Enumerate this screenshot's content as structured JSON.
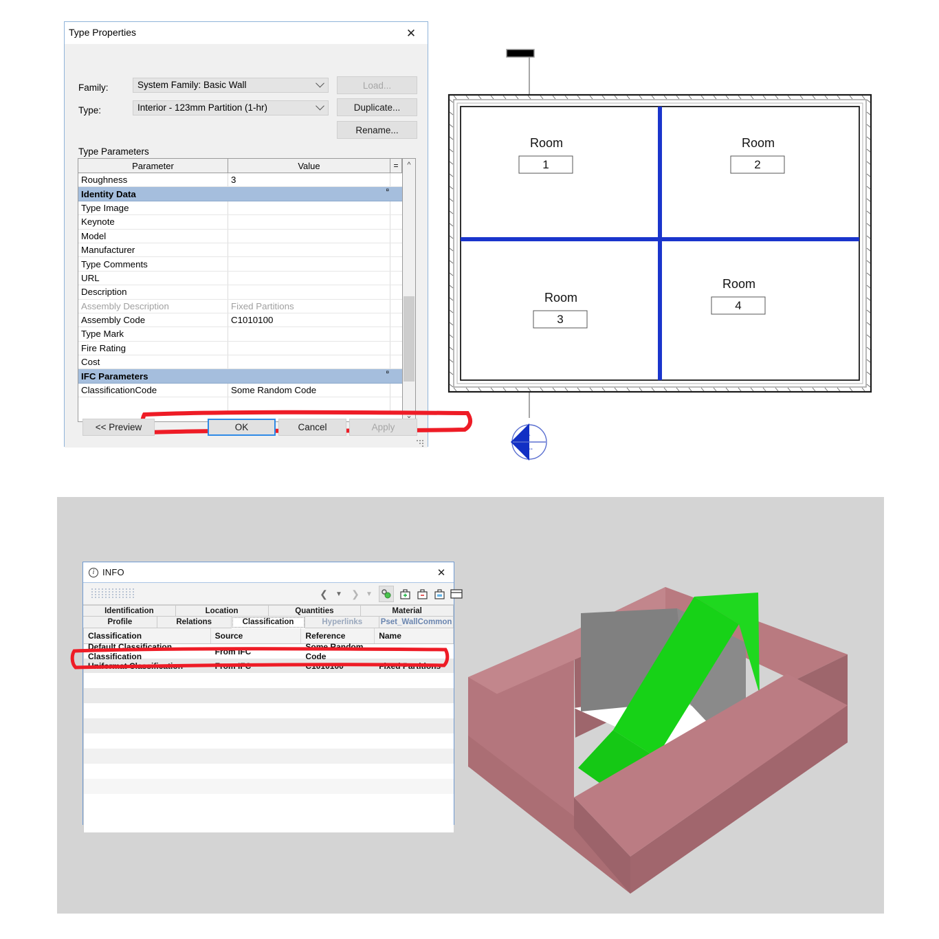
{
  "type_properties": {
    "title": "Type Properties",
    "close_label": "✕",
    "family_label": "Family:",
    "family_value": "System Family: Basic Wall",
    "type_label": "Type:",
    "type_value": "Interior - 123mm Partition (1-hr)",
    "load_button": "Load...",
    "duplicate_button": "Duplicate...",
    "rename_button": "Rename...",
    "type_parameters_label": "Type Parameters",
    "columns": {
      "parameter": "Parameter",
      "value": "Value",
      "equals": "="
    },
    "rows": [
      {
        "kind": "param",
        "parameter": "Roughness",
        "value": "3"
      },
      {
        "kind": "group",
        "parameter": "Identity Data",
        "value": ""
      },
      {
        "kind": "param",
        "parameter": "Type Image",
        "value": ""
      },
      {
        "kind": "param",
        "parameter": "Keynote",
        "value": ""
      },
      {
        "kind": "param",
        "parameter": "Model",
        "value": ""
      },
      {
        "kind": "param",
        "parameter": "Manufacturer",
        "value": ""
      },
      {
        "kind": "param",
        "parameter": "Type Comments",
        "value": ""
      },
      {
        "kind": "param",
        "parameter": "URL",
        "value": ""
      },
      {
        "kind": "param",
        "parameter": "Description",
        "value": ""
      },
      {
        "kind": "dim",
        "parameter": "Assembly Description",
        "value": "Fixed Partitions"
      },
      {
        "kind": "param",
        "parameter": "Assembly Code",
        "value": "C1010100"
      },
      {
        "kind": "param",
        "parameter": "Type Mark",
        "value": ""
      },
      {
        "kind": "param",
        "parameter": "Fire Rating",
        "value": ""
      },
      {
        "kind": "param",
        "parameter": "Cost",
        "value": ""
      },
      {
        "kind": "group",
        "parameter": "IFC Parameters",
        "value": ""
      },
      {
        "kind": "param",
        "parameter": "ClassificationCode",
        "value": "Some Random Code"
      },
      {
        "kind": "blank",
        "parameter": "",
        "value": ""
      }
    ],
    "preview_button": "<< Preview",
    "ok_button": "OK",
    "cancel_button": "Cancel",
    "apply_button": "Apply",
    "highlight_color": "#ee1c26",
    "group_row_color": "#a5bedd"
  },
  "floor_plan": {
    "rooms": [
      {
        "name": "Room",
        "number": "1"
      },
      {
        "name": "Room",
        "number": "2"
      },
      {
        "name": "Room",
        "number": "3"
      },
      {
        "name": "Room",
        "number": "4"
      }
    ],
    "interior_wall_color": "#1a35cc",
    "section_marker": {
      "head_label": "-",
      "tail_label": "---",
      "color": "#1230c4"
    }
  },
  "info_dialog": {
    "title": "INFO",
    "info_icon": "i",
    "close_label": "✕",
    "toolbar_icons": [
      "prev-icon",
      "prev-dropdown-icon",
      "next-icon",
      "next-dropdown-icon",
      "property-link-icon",
      "add-property-icon",
      "remove-property-icon",
      "edit-property-icon",
      "layout-icon"
    ],
    "tabs_row1": [
      {
        "label": "Identification",
        "state": "normal"
      },
      {
        "label": "Location",
        "state": "normal"
      },
      {
        "label": "Quantities",
        "state": "normal"
      },
      {
        "label": "Material",
        "state": "normal"
      }
    ],
    "tabs_row2": [
      {
        "label": "Profile",
        "state": "normal"
      },
      {
        "label": "Relations",
        "state": "normal"
      },
      {
        "label": "Classification",
        "state": "active"
      },
      {
        "label": "Hyperlinks",
        "state": "muted"
      },
      {
        "label": "Pset_WallCommon",
        "state": "linkish"
      }
    ],
    "columns": [
      "Classification",
      "Source",
      "Reference",
      "Name"
    ],
    "rows": [
      {
        "classification": "Default Classification Classification",
        "source": "From IFC",
        "reference": "Some Random Code",
        "name": ""
      },
      {
        "classification": "Uniformat Classification",
        "source": "From IFC",
        "reference": "C1010100",
        "name": "Fixed Partitions"
      }
    ],
    "highlight_color": "#ee1c26"
  },
  "view_3d": {
    "name": "wall-assembly-3d-view",
    "wall_color": "#ab6e74",
    "highlight_face_color": "#17d217",
    "neutral_face_color": "#808080",
    "background_color": "#d4d4d4"
  }
}
